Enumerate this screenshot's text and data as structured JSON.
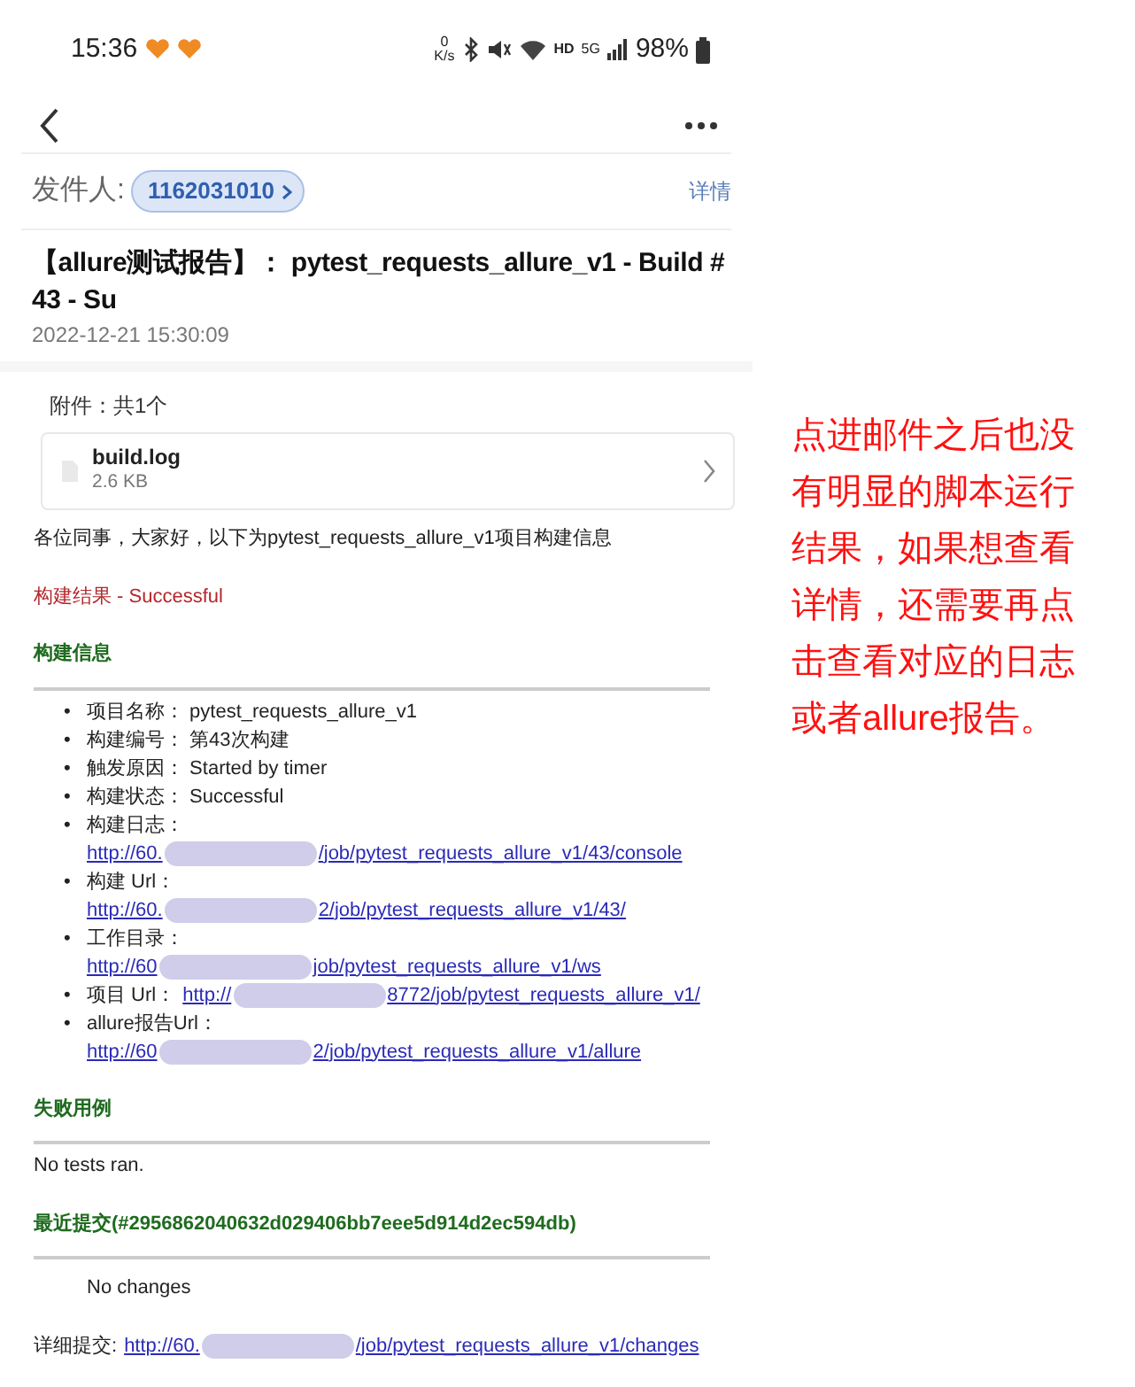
{
  "status_bar": {
    "time": "15:36",
    "net_speed_value": "0",
    "net_speed_unit": "K/s",
    "hd": "HD",
    "network": "5G",
    "battery": "98%"
  },
  "sender": {
    "label": "发件人:",
    "name": "1162031010",
    "details": "详情"
  },
  "subject": "【allure测试报告】： pytest_requests_allure_v1 - Build # 43 - Su",
  "date": "2022-12-21 15:30:09",
  "attachments": {
    "label": "附件：共1个",
    "files": [
      {
        "name": "build.log",
        "size": "2.6 KB"
      }
    ]
  },
  "body": {
    "greeting": "各位同事，大家好，以下为pytest_requests_allure_v1项目构建信息",
    "result": "构建结果 - Successful",
    "info_heading": "构建信息",
    "items": [
      {
        "kind": "text",
        "marker": "•",
        "label": "项目名称：",
        "value": "pytest_requests_allure_v1"
      },
      {
        "kind": "text",
        "marker": "•",
        "label": "构建编号：",
        "value": "第43次构建"
      },
      {
        "kind": "text",
        "marker": "•",
        "label": "触发原因：",
        "value": "Started by timer"
      },
      {
        "kind": "text",
        "marker": "•",
        "label": "构建状态：",
        "value": "Successful"
      },
      {
        "kind": "link",
        "marker": "•",
        "label": "构建日志：",
        "link_start": "http://60.",
        "link_end": "/job/pytest_requests_allure_v1/43/console"
      },
      {
        "kind": "link",
        "marker": "•",
        "label": "构建 Url：",
        "link_start": "http://60.",
        "link_end": "2/job/pytest_requests_allure_v1/43/"
      },
      {
        "kind": "link",
        "marker": "•",
        "label": "工作目录：",
        "link_start": "http://60",
        "link_end": "job/pytest_requests_allure_v1/ws"
      },
      {
        "kind": "inline_link",
        "marker": "•",
        "label": "项目 Url：",
        "link_start": "http://",
        "link_end": "8772/job/pytest_requests_allure_v1/"
      },
      {
        "kind": "link",
        "marker": "•",
        "label": "allure报告Url：",
        "link_start": "http://60",
        "link_end": "2/job/pytest_requests_allure_v1/allure"
      }
    ],
    "failed_heading": "失败用例",
    "failed_text": "No tests ran.",
    "commit_heading": "最近提交(#2956862040632d029406bb7eee5d914d2ec594db)",
    "changes_text": "No changes",
    "detail_label": "详细提交:",
    "detail_link_start": "http://60.",
    "detail_link_end": "/job/pytest_requests_allure_v1/changes"
  },
  "annotation": "点进邮件之后也没有明显的脚本运行结果，如果想查看详情，还需要再点击查看对应的日志或者allure报告。"
}
